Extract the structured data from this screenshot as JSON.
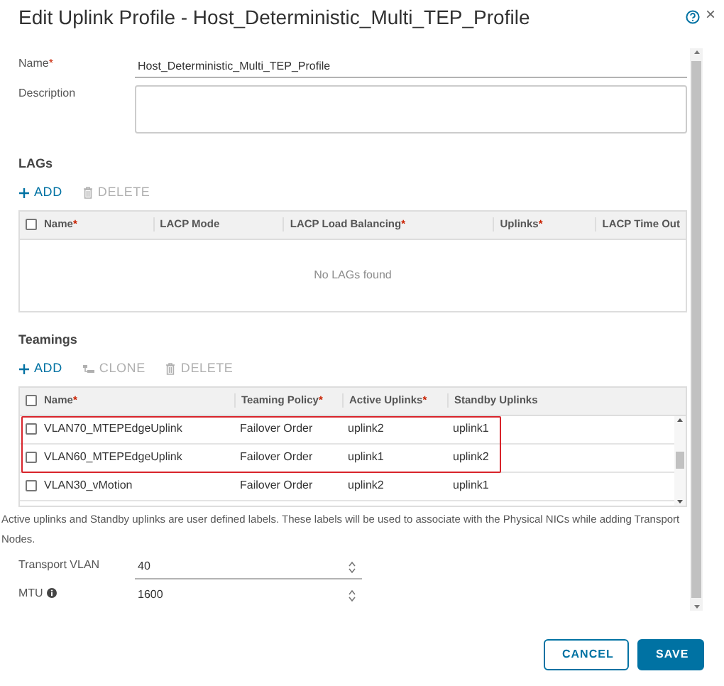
{
  "dialog": {
    "title": "Edit Uplink Profile - Host_Deterministic_Multi_TEP_Profile",
    "close": "×"
  },
  "name_field": {
    "label": "Name",
    "required_mark": "*",
    "value": "Host_Deterministic_Multi_TEP_Profile"
  },
  "description_field": {
    "label": "Description"
  },
  "lags": {
    "heading": "LAGs",
    "toolbar": [
      {
        "label": "ADD",
        "kind": "add",
        "disabled": false
      },
      {
        "label": "DELETE",
        "kind": "delete",
        "disabled": true
      }
    ],
    "select_all_checked": false,
    "columns": [
      {
        "label": "Name",
        "required_mark": "*"
      },
      {
        "label": "LACP Mode"
      },
      {
        "label": "LACP Load Balancing",
        "required_mark": "*"
      },
      {
        "label": "Uplinks",
        "required_mark": "*"
      },
      {
        "label": "LACP Time Out"
      }
    ],
    "empty_message": "No LAGs found"
  },
  "teamings": {
    "heading": "Teamings",
    "toolbar": [
      {
        "label": "ADD",
        "kind": "add",
        "disabled": false
      },
      {
        "label": "CLONE",
        "kind": "clone",
        "disabled": true
      },
      {
        "label": "DELETE",
        "kind": "delete",
        "disabled": true
      }
    ],
    "select_all_checked": false,
    "columns": [
      {
        "label": "Name",
        "required_mark": "*"
      },
      {
        "label": "Teaming Policy",
        "required_mark": "*"
      },
      {
        "label": "Active Uplinks",
        "required_mark": "*"
      },
      {
        "label": "Standby Uplinks"
      }
    ],
    "rows": [
      {
        "cells": [
          "VLAN70_MTEPEdgeUplink",
          "Failover Order",
          "uplink2",
          "uplink1"
        ],
        "checked": false,
        "highlighted": true
      },
      {
        "cells": [
          "VLAN60_MTEPEdgeUplink",
          "Failover Order",
          "uplink1",
          "uplink2"
        ],
        "checked": false,
        "highlighted": true
      },
      {
        "cells": [
          "VLAN30_vMotion",
          "Failover Order",
          "uplink2",
          "uplink1"
        ],
        "checked": false,
        "highlighted": false
      }
    ],
    "note": "Active uplinks and Standby uplinks are user defined labels. These labels will be used to associate with the Physical NICs while adding Transport Nodes."
  },
  "transport_vlan": {
    "label": "Transport VLAN",
    "value": "40",
    "info": false
  },
  "mtu": {
    "label": "MTU",
    "value": "1600",
    "info": true
  },
  "buttons": [
    {
      "label": "CANCEL",
      "kind": "secondary"
    },
    {
      "label": "SAVE",
      "kind": "primary"
    }
  ]
}
